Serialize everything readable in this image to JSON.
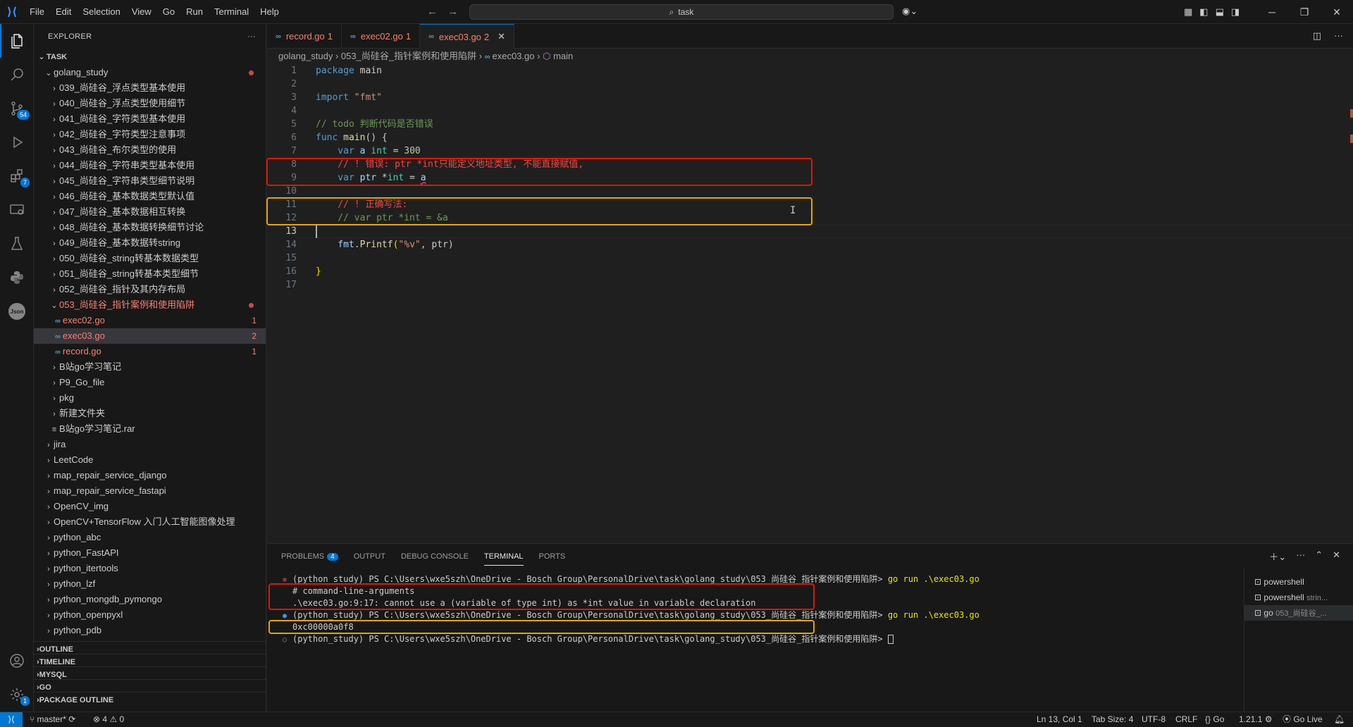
{
  "menu": [
    "File",
    "Edit",
    "Selection",
    "View",
    "Go",
    "Run",
    "Terminal",
    "Help"
  ],
  "search": {
    "label": "task"
  },
  "sidebar": {
    "title": "EXPLORER",
    "root": "TASK",
    "items": [
      {
        "label": "golang_study",
        "depth": 1,
        "type": "folder-open",
        "dot": true
      },
      {
        "label": "039_尚硅谷_浮点类型基本使用",
        "depth": 2,
        "type": "folder"
      },
      {
        "label": "040_尚硅谷_浮点类型使用细节",
        "depth": 2,
        "type": "folder"
      },
      {
        "label": "041_尚硅谷_字符类型基本使用",
        "depth": 2,
        "type": "folder"
      },
      {
        "label": "042_尚硅谷_字符类型注意事项",
        "depth": 2,
        "type": "folder"
      },
      {
        "label": "043_尚硅谷_布尔类型的使用",
        "depth": 2,
        "type": "folder"
      },
      {
        "label": "044_尚硅谷_字符串类型基本使用",
        "depth": 2,
        "type": "folder"
      },
      {
        "label": "045_尚硅谷_字符串类型细节说明",
        "depth": 2,
        "type": "folder"
      },
      {
        "label": "046_尚硅谷_基本数据类型默认值",
        "depth": 2,
        "type": "folder"
      },
      {
        "label": "047_尚硅谷_基本数据相互转换",
        "depth": 2,
        "type": "folder"
      },
      {
        "label": "048_尚硅谷_基本数据转换细节讨论",
        "depth": 2,
        "type": "folder"
      },
      {
        "label": "049_尚硅谷_基本数据转string",
        "depth": 2,
        "type": "folder"
      },
      {
        "label": "050_尚硅谷_string转基本数据类型",
        "depth": 2,
        "type": "folder"
      },
      {
        "label": "051_尚硅谷_string转基本类型细节",
        "depth": 2,
        "type": "folder"
      },
      {
        "label": "052_尚硅谷_指针及其内存布局",
        "depth": 2,
        "type": "folder"
      },
      {
        "label": "053_尚硅谷_指针案例和使用陷阱",
        "depth": 2,
        "type": "folder-open",
        "dot": true,
        "err": true
      },
      {
        "label": "exec02.go",
        "depth": 3,
        "type": "go",
        "count": "1",
        "err": true
      },
      {
        "label": "exec03.go",
        "depth": 3,
        "type": "go",
        "count": "2",
        "err": true,
        "selected": true
      },
      {
        "label": "record.go",
        "depth": 3,
        "type": "go",
        "count": "1",
        "err": true
      },
      {
        "label": "B站go学习笔记",
        "depth": 2,
        "type": "folder"
      },
      {
        "label": "P9_Go_file",
        "depth": 2,
        "type": "folder"
      },
      {
        "label": "pkg",
        "depth": 2,
        "type": "folder"
      },
      {
        "label": "新建文件夹",
        "depth": 2,
        "type": "folder"
      },
      {
        "label": "B站go学习笔记.rar",
        "depth": 2,
        "type": "file"
      },
      {
        "label": "jira",
        "depth": 1,
        "type": "folder"
      },
      {
        "label": "LeetCode",
        "depth": 1,
        "type": "folder"
      },
      {
        "label": "map_repair_service_django",
        "depth": 1,
        "type": "folder"
      },
      {
        "label": "map_repair_service_fastapi",
        "depth": 1,
        "type": "folder"
      },
      {
        "label": "OpenCV_img",
        "depth": 1,
        "type": "folder"
      },
      {
        "label": "OpenCV+TensorFlow 入门人工智能图像处理",
        "depth": 1,
        "type": "folder"
      },
      {
        "label": "python_abc",
        "depth": 1,
        "type": "folder"
      },
      {
        "label": "python_FastAPI",
        "depth": 1,
        "type": "folder"
      },
      {
        "label": "python_itertools",
        "depth": 1,
        "type": "folder"
      },
      {
        "label": "python_lzf",
        "depth": 1,
        "type": "folder"
      },
      {
        "label": "python_mongdb_pymongo",
        "depth": 1,
        "type": "folder"
      },
      {
        "label": "python_openpyxl",
        "depth": 1,
        "type": "folder"
      },
      {
        "label": "python_pdb",
        "depth": 1,
        "type": "folder"
      }
    ],
    "sections": [
      "OUTLINE",
      "TIMELINE",
      "MYSQL",
      "GO",
      "PACKAGE OUTLINE"
    ]
  },
  "activity": {
    "scm_badge": "54",
    "ext_badge": "7",
    "settings_badge": "1",
    "json_label": "Json"
  },
  "tabs": [
    {
      "label": "record.go",
      "count": "1"
    },
    {
      "label": "exec02.go",
      "count": "1"
    },
    {
      "label": "exec03.go",
      "count": "2",
      "active": true
    }
  ],
  "breadcrumb": [
    "golang_study",
    "053_尚硅谷_指针案例和使用陷阱",
    "exec03.go",
    "main"
  ],
  "code": {
    "line_numbers": [
      "1",
      "2",
      "3",
      "4",
      "5",
      "6",
      "7",
      "8",
      "9",
      "10",
      "11",
      "12",
      "13",
      "14",
      "15",
      "16",
      "17"
    ],
    "l1_kw": "package",
    "l1_name": " main",
    "l3_kw": "import",
    "l3_str": " \"fmt\"",
    "l5": "// todo 判断代码是否错误",
    "l6_kw": "func",
    "l6_fn": " main",
    "l6_rest": "() {",
    "l7_kw": "    var",
    "l7_var": " a",
    "l7_ty": " int",
    "l7_eq": " = ",
    "l7_num": "300",
    "l8": "    // ! 错误: ptr *int只能定义地址类型, 不能直接赋值,",
    "l9_kw": "    var",
    "l9_var": " ptr",
    "l9_rest": " *",
    "l9_ty": "int",
    "l9_eq": " = ",
    "l9_a": "a",
    "l11": "    // ! 正确写法:",
    "l12": "    // var ptr *int = &a",
    "l14_pkg": "    fmt",
    "l14_dot": ".",
    "l14_fn": "Printf",
    "l14_open": "(",
    "l14_str": "\"%v\"",
    "l14_rest": ", ptr)",
    "l16": "}"
  },
  "panel": {
    "tabs": [
      "PROBLEMS",
      "OUTPUT",
      "DEBUG CONSOLE",
      "TERMINAL",
      "PORTS"
    ],
    "problems_badge": "4",
    "terminal_lines": [
      "(python_study) PS C:\\Users\\wxe5szh\\OneDrive - Bosch Group\\PersonalDrive\\task\\golang_study\\053_尚硅谷_指针案例和使用陷阱>",
      "# command-line-arguments",
      ".\\exec03.go:9:17: cannot use a (variable of type int) as *int value in variable declaration",
      "(python_study) PS C:\\Users\\wxe5szh\\OneDrive - Bosch Group\\PersonalDrive\\task\\golang_study\\053_尚硅谷_指针案例和使用陷阱>",
      "0xc00000a0f8",
      "(python_study) PS C:\\Users\\wxe5szh\\OneDrive - Bosch Group\\PersonalDrive\\task\\golang_study\\053_尚硅谷_指针案例和使用陷阱>"
    ],
    "cmd": "go run .\\exec03.go",
    "terminals": [
      {
        "name": "powershell",
        "sub": ""
      },
      {
        "name": "powershell",
        "sub": "strin..."
      },
      {
        "name": "go",
        "sub": "053_尚硅谷_..."
      }
    ]
  },
  "status": {
    "branch": "master*",
    "errors": "4",
    "warnings": "0",
    "position": "Ln 13, Col 1",
    "tabsize": "Tab Size: 4",
    "encoding": "UTF-8",
    "eol": "CRLF",
    "lang": "Go",
    "version": "1.21.1",
    "golive": "Go Live"
  },
  "colors": {
    "accent": "#0078d4",
    "error": "#f88070",
    "red_box": "#e51400",
    "orange_box": "#e5a500"
  }
}
